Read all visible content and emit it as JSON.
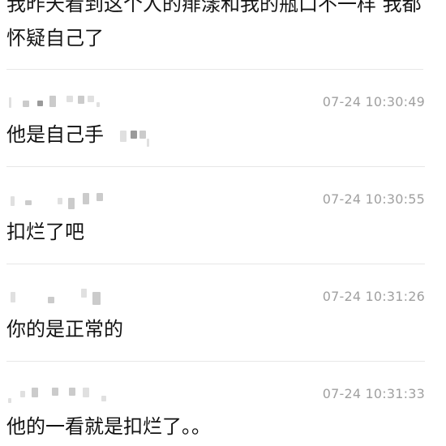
{
  "top_message": {
    "text": "我昨天看到这个人的痱漾和我的瓶口不一样 我都怀疑自己了"
  },
  "comments": [
    {
      "time": "07-24 10:30:49",
      "text": "他是自己手"
    },
    {
      "time": "07-24 10:30:55",
      "text": "扣烂了吧"
    },
    {
      "time": "07-24 10:31:26",
      "text": "你的是正常的"
    },
    {
      "time": "07-24 10:31:33",
      "text": "他的一看就是扣烂了。。"
    }
  ]
}
